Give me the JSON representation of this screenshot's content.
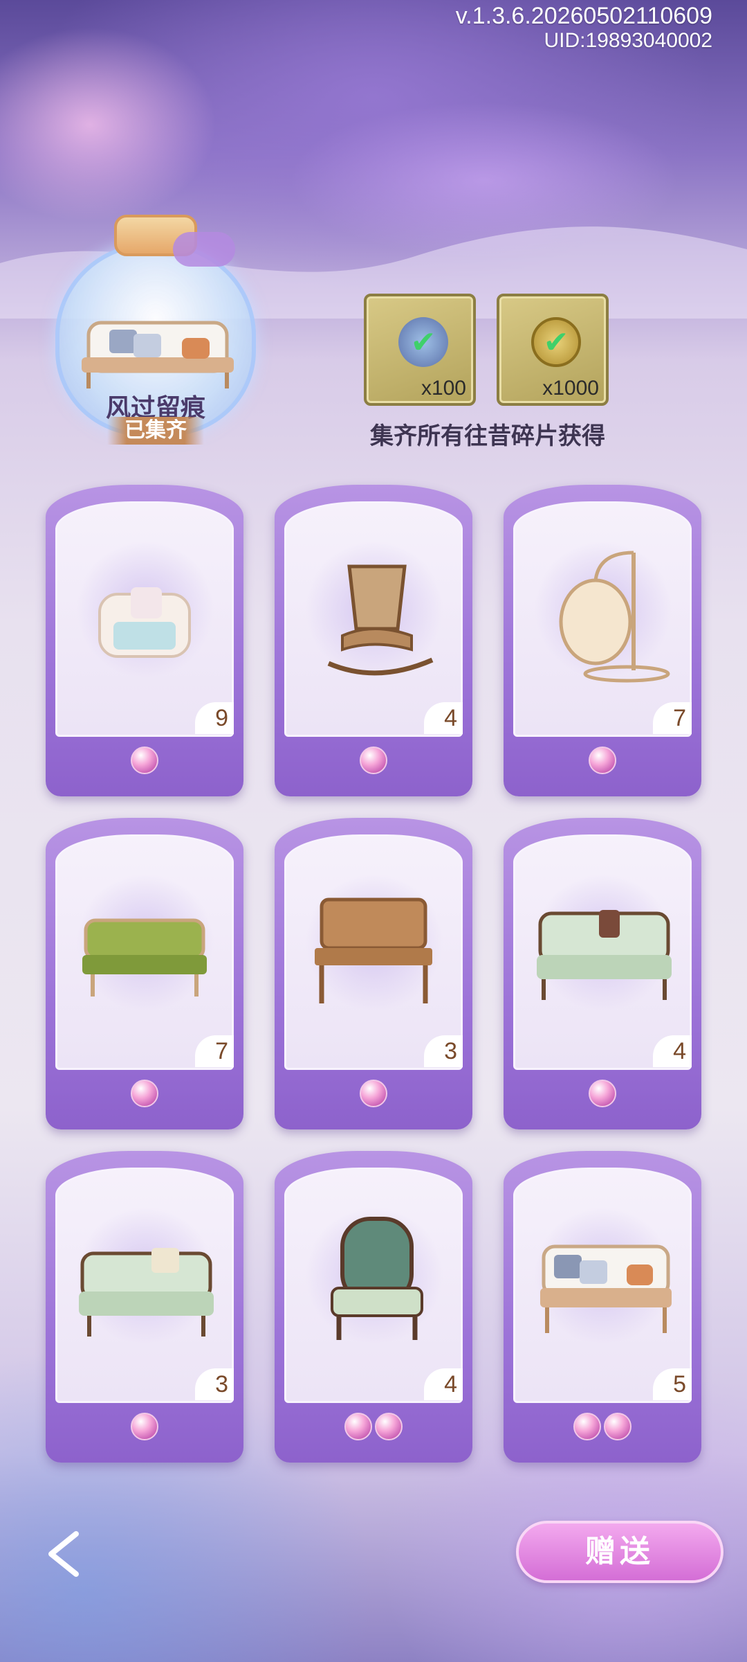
{
  "header": {
    "version": "v.1.3.6.20260502110609",
    "uid": "UID:19893040002"
  },
  "set": {
    "title": "风过留痕",
    "status": "已集齐"
  },
  "rewards": [
    {
      "icon": "stamina-crystal-icon",
      "count": "x100"
    },
    {
      "icon": "clover-coin-icon",
      "count": "x1000"
    }
  ],
  "rewards_caption": "集齐所有往昔碎片获得",
  "cards": [
    {
      "name": "white-armchair",
      "count": "9",
      "pearls": 1
    },
    {
      "name": "rattan-rocking-chair",
      "count": "4",
      "pearls": 1
    },
    {
      "name": "hanging-egg-chair",
      "count": "7",
      "pearls": 1
    },
    {
      "name": "green-floral-bench",
      "count": "7",
      "pearls": 1
    },
    {
      "name": "wooden-park-bench",
      "count": "3",
      "pearls": 1
    },
    {
      "name": "mint-carved-sofa",
      "count": "4",
      "pearls": 1
    },
    {
      "name": "mint-settee",
      "count": "3",
      "pearls": 1
    },
    {
      "name": "green-armchair",
      "count": "4",
      "pearls": 2
    },
    {
      "name": "white-loveseat",
      "count": "5",
      "pearls": 2
    }
  ],
  "footer": {
    "gift_label": "赠送"
  }
}
